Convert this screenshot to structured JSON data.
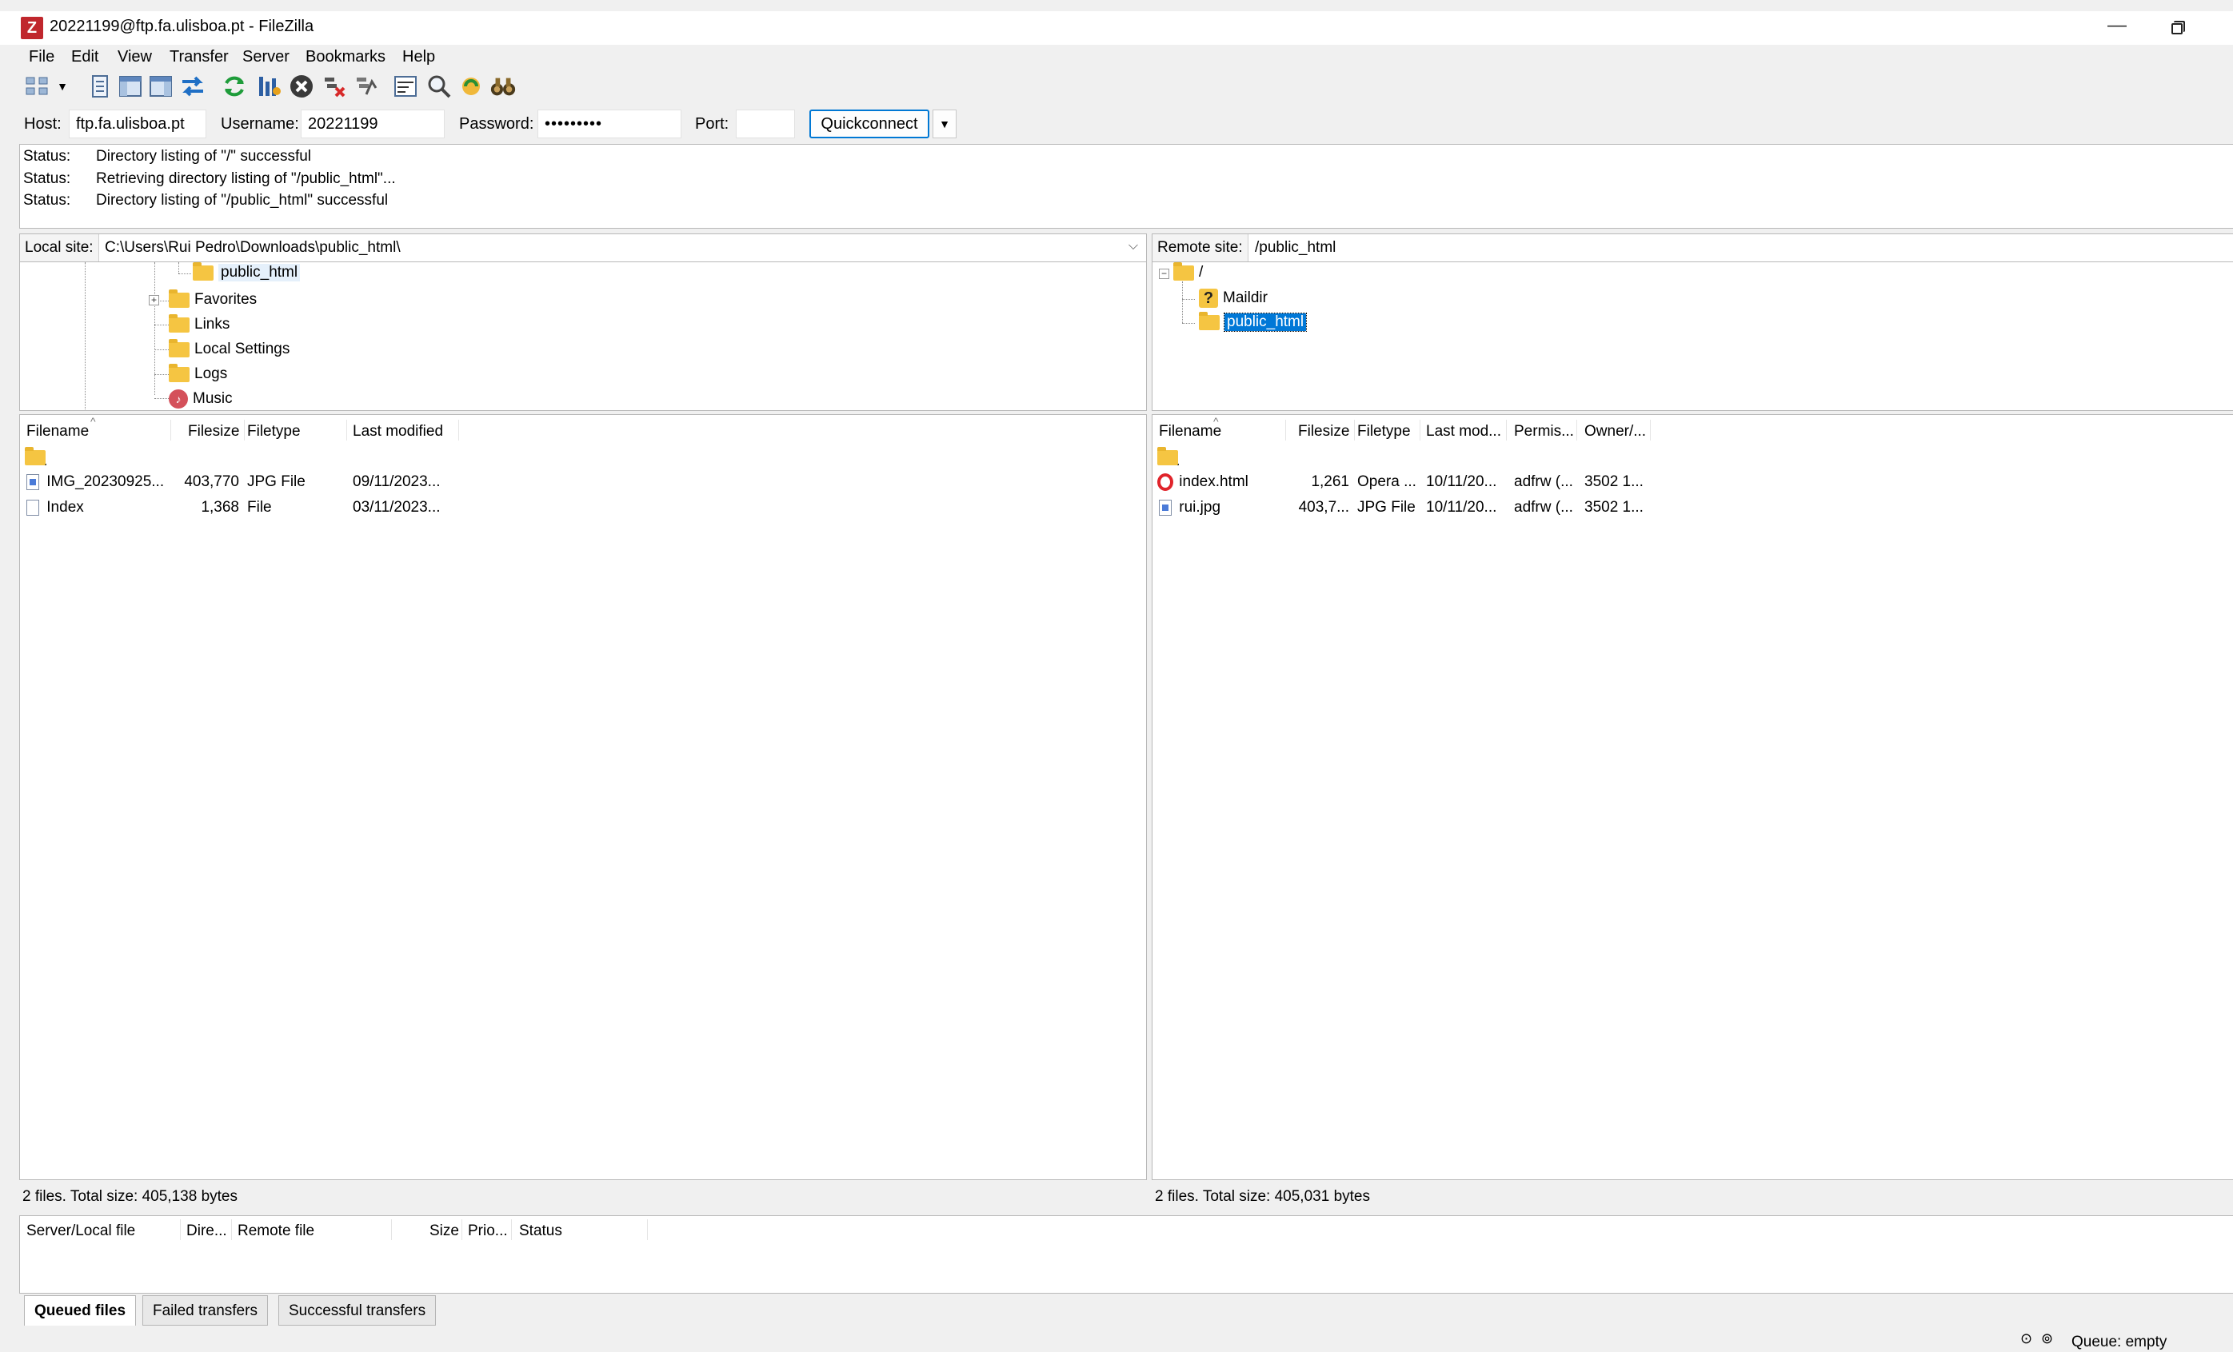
{
  "window": {
    "app_icon": "Z",
    "title": "20221199@ftp.fa.ulisboa.pt - FileZilla",
    "minimize_glyph": "—"
  },
  "menu": [
    "File",
    "Edit",
    "View",
    "Transfer",
    "Server",
    "Bookmarks",
    "Help"
  ],
  "toolbar_icons": [
    "site-manager-icon",
    "dropdown-arrow-icon",
    "message-log-icon",
    "local-tree-icon",
    "remote-tree-icon",
    "transfer-queue-icon",
    "refresh-icon",
    "process-queue-icon",
    "cancel-icon",
    "disconnect-icon",
    "reconnect-icon",
    "filter-icon",
    "compare-icon",
    "sync-browse-icon",
    "search-icon"
  ],
  "quickconnect": {
    "host_label": "Host:",
    "host_value": "ftp.fa.ulisboa.pt",
    "username_label": "Username:",
    "username_value": "20221199",
    "password_label": "Password:",
    "password_value": "•••••••••",
    "port_label": "Port:",
    "port_value": "",
    "button_label": "Quickconnect",
    "dropdown_glyph": "▼"
  },
  "log": [
    {
      "label": "Status:",
      "text": "Directory listing of \"/\" successful"
    },
    {
      "label": "Status:",
      "text": "Retrieving directory listing of \"/public_html\"..."
    },
    {
      "label": "Status:",
      "text": "Directory listing of \"/public_html\" successful"
    }
  ],
  "local": {
    "site_label": "Local site:",
    "path": "C:\\Users\\Rui Pedro\\Downloads\\public_html\\",
    "tree": [
      "public_html",
      "Favorites",
      "Links",
      "Local Settings",
      "Logs",
      "Music"
    ],
    "columns": [
      "Filename",
      "Filesize",
      "Filetype",
      "Last modified"
    ],
    "up_dir": "..",
    "files": [
      {
        "name": "IMG_20230925...",
        "size": "403,770",
        "type": "JPG File",
        "modified": "09/11/2023..."
      },
      {
        "name": "Index",
        "size": "1,368",
        "type": "File",
        "modified": "03/11/2023..."
      }
    ],
    "status": "2 files. Total size: 405,138 bytes"
  },
  "remote": {
    "site_label": "Remote site:",
    "path": "/public_html",
    "tree": [
      "/",
      "Maildir",
      "public_html"
    ],
    "columns": [
      "Filename",
      "Filesize",
      "Filetype",
      "Last mod...",
      "Permis...",
      "Owner/..."
    ],
    "up_dir": "..",
    "files": [
      {
        "name": "index.html",
        "size": "1,261",
        "type": "Opera ...",
        "modified": "10/11/20...",
        "perms": "adfrw (...",
        "owner": "3502 1..."
      },
      {
        "name": "rui.jpg",
        "size": "403,7...",
        "type": "JPG File",
        "modified": "10/11/20...",
        "perms": "adfrw (...",
        "owner": "3502 1..."
      }
    ],
    "status": "2 files. Total size: 405,031 bytes"
  },
  "queue": {
    "columns": [
      "Server/Local file",
      "Dire...",
      "Remote file",
      "Size",
      "Prio...",
      "Status"
    ],
    "tabs": [
      "Queued files",
      "Failed transfers",
      "Successful transfers"
    ],
    "status": "Queue: empty"
  }
}
